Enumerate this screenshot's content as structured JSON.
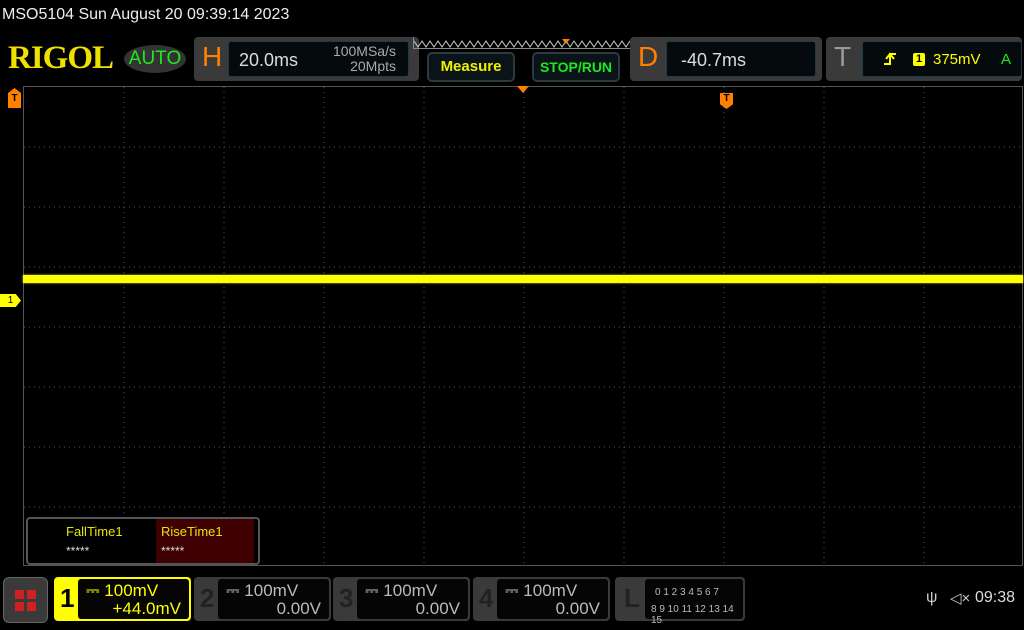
{
  "title": "MSO5104  Sun August 20 09:39:14 2023",
  "logo": "RIGOL",
  "mode": "AUTO",
  "horizontal": {
    "label": "H",
    "timebase": "20.0ms",
    "sample_rate": "100MSa/s",
    "memory_depth": "20Mpts"
  },
  "buttons": {
    "measure": "Measure",
    "stop_run": "STOP/RUN"
  },
  "delay": {
    "label": "D",
    "value": "-40.7ms"
  },
  "trigger": {
    "label": "T",
    "source": "1",
    "level": "375mV",
    "sweep": "A",
    "slope_icon": "rising-edge-icon"
  },
  "markers": {
    "trigger_position": "T",
    "channel1": "1"
  },
  "measurements": [
    {
      "name": "FallTime1",
      "value": "*****"
    },
    {
      "name": "RiseTime1",
      "value": "*****"
    }
  ],
  "channels": [
    {
      "num": "1",
      "scale": "100mV",
      "offset": "+44.0mV",
      "color": "#ffff00",
      "active": true
    },
    {
      "num": "2",
      "scale": "100mV",
      "offset": "0.00V",
      "active": false
    },
    {
      "num": "3",
      "scale": "100mV",
      "offset": "0.00V",
      "active": false
    },
    {
      "num": "4",
      "scale": "100mV",
      "offset": "0.00V",
      "active": false
    }
  ],
  "logic": {
    "label": "L",
    "row1": "0 1 2 3  4 5 6 7",
    "row2": "8 9 10 11 12 13 14 15"
  },
  "status": {
    "clock": "09:38",
    "usb_icon": "usb-icon",
    "sound_icon": "mute-icon"
  }
}
